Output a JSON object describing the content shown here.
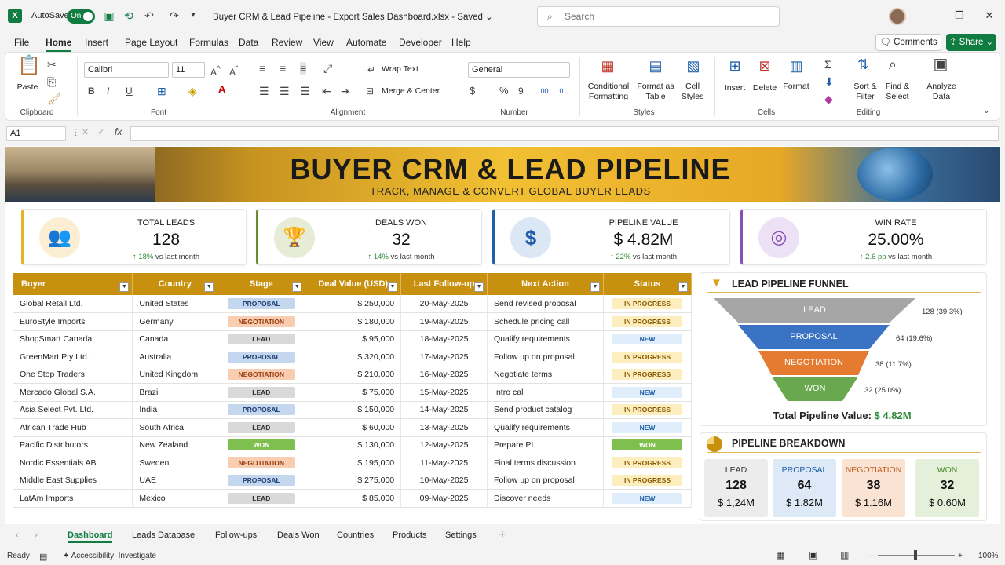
{
  "app": {
    "autosave_label": "AutoSave",
    "autosave_state": "On",
    "doc_title": "Buyer CRM & Lead Pipeline - Export Sales Dashboard.xlsx",
    "save_status": "Saved",
    "search_placeholder": "Search"
  },
  "menu": {
    "items": [
      "File",
      "Home",
      "Insert",
      "Page Layout",
      "Formulas",
      "Data",
      "Review",
      "View",
      "Automate",
      "Developer",
      "Help"
    ],
    "active": "Home",
    "comments_label": "Comments",
    "share_label": "Share"
  },
  "ribbon": {
    "clipboard": {
      "paste": "Paste",
      "group": "Clipboard"
    },
    "font": {
      "name": "Calibri",
      "size": "11",
      "group": "Font"
    },
    "alignment": {
      "wrap": "Wrap Text",
      "merge": "Merge & Center",
      "group": "Alignment"
    },
    "number": {
      "format": "General",
      "group": "Number"
    },
    "styles": {
      "cond": "Conditional Formatting",
      "fmt_table": "Format as Table",
      "cell_styles": "Cell Styles",
      "group": "Styles"
    },
    "cells": {
      "insert": "Insert",
      "delete": "Delete",
      "format": "Format",
      "group": "Cells"
    },
    "editing": {
      "sort": "Sort & Filter",
      "find": "Find & Select",
      "group": "Editing"
    },
    "analyze": "Analyze Data"
  },
  "formula_bar": {
    "cell": "A1",
    "fx": "fx"
  },
  "banner": {
    "title": "BUYER CRM & LEAD PIPELINE",
    "subtitle": "TRACK, MANAGE & CONVERT GLOBAL BUYER LEADS"
  },
  "kpis": [
    {
      "title": "TOTAL LEADS",
      "value": "128",
      "change": "18%",
      "suffix": "vs last month",
      "color": "#e8b12a",
      "bg": "#fbeed3"
    },
    {
      "title": "DEALS WON",
      "value": "32",
      "change": "14%",
      "suffix": "vs last month",
      "color": "#6d8a2b",
      "bg": "#e6ecd6"
    },
    {
      "title": "PIPELINE VALUE",
      "value": "$ 4.82M",
      "change": "22%",
      "suffix": "vs last month",
      "color": "#1f5ea8",
      "bg": "#dbe7f4"
    },
    {
      "title": "WIN RATE",
      "value": "25.00%",
      "change": "2.6 pp",
      "suffix": "vs last month",
      "color": "#8a4fb4",
      "bg": "#ede2f5"
    }
  ],
  "table": {
    "headers": [
      "Buyer",
      "Country",
      "Stage",
      "Deal Value (USD)",
      "Last Follow-up",
      "Next Action",
      "Status"
    ],
    "rows": [
      [
        "Global Retail Ltd.",
        "United States",
        "PROPOSAL",
        "$ 250,000",
        "20-May-2025",
        "Send revised proposal",
        "IN PROGRESS"
      ],
      [
        "EuroStyle Imports",
        "Germany",
        "NEGOTIATION",
        "$ 180,000",
        "19-May-2025",
        "Schedule pricing call",
        "IN PROGRESS"
      ],
      [
        "ShopSmart Canada",
        "Canada",
        "LEAD",
        "$ 95,000",
        "18-May-2025",
        "Qualify requirements",
        "NEW"
      ],
      [
        "GreenMart Pty Ltd.",
        "Australia",
        "PROPOSAL",
        "$ 320,000",
        "17-May-2025",
        "Follow up on proposal",
        "IN PROGRESS"
      ],
      [
        "One Stop Traders",
        "United Kingdom",
        "NEGOTIATION",
        "$ 210,000",
        "16-May-2025",
        "Negotiate terms",
        "IN PROGRESS"
      ],
      [
        "Mercado Global S.A.",
        "Brazil",
        "LEAD",
        "$ 75,000",
        "15-May-2025",
        "Intro call",
        "NEW"
      ],
      [
        "Asia Select Pvt. Ltd.",
        "India",
        "PROPOSAL",
        "$ 150,000",
        "14-May-2025",
        "Send product catalog",
        "IN PROGRESS"
      ],
      [
        "African Trade Hub",
        "South Africa",
        "LEAD",
        "$ 60,000",
        "13-May-2025",
        "Qualify requirements",
        "NEW"
      ],
      [
        "Pacific Distributors",
        "New Zealand",
        "WON",
        "$ 130,000",
        "12-May-2025",
        "Prepare PI",
        "WON"
      ],
      [
        "Nordic Essentials AB",
        "Sweden",
        "NEGOTIATION",
        "$ 195,000",
        "11-May-2025",
        "Final terms discussion",
        "IN PROGRESS"
      ],
      [
        "Middle East Supplies",
        "UAE",
        "PROPOSAL",
        "$ 275,000",
        "10-May-2025",
        "Follow up on proposal",
        "IN PROGRESS"
      ],
      [
        "LatAm Imports",
        "Mexico",
        "LEAD",
        "$ 85,000",
        "09-May-2025",
        "Discover needs",
        "NEW"
      ]
    ]
  },
  "stage_colors": {
    "PROPOSAL": [
      "#c5d6ef",
      "#1d3f73"
    ],
    "NEGOTIATION": [
      "#f8cdb2",
      "#9a3d10"
    ],
    "LEAD": [
      "#d9d9d9",
      "#333333"
    ],
    "WON": [
      "#7fbf4d",
      "#ffffff"
    ]
  },
  "status_colors": {
    "IN PROGRESS": [
      "#fdeec0",
      "#8a5a00"
    ],
    "NEW": [
      "#dfeefa",
      "#1f5ea8"
    ],
    "WON": [
      "#7fbf4d",
      "#ffffff"
    ]
  },
  "funnel": {
    "title": "LEAD PIPELINE FUNNEL",
    "stages": [
      {
        "name": "LEAD",
        "label": "128 (39.3%)",
        "color": "#a6a6a6"
      },
      {
        "name": "PROPOSAL",
        "label": "64 (19.6%)",
        "color": "#3a73c4"
      },
      {
        "name": "NEGOTIATION",
        "label": "38 (11.7%)",
        "color": "#e57a31"
      },
      {
        "name": "WON",
        "label": "32 (25.0%)",
        "color": "#6aa84f"
      }
    ],
    "total_label": "Total Pipeline Value:",
    "total_value": "$ 4.82M"
  },
  "breakdown": {
    "title": "PIPELINE BREAKDOWN",
    "items": [
      {
        "name": "LEAD",
        "count": "128",
        "amount": "$ 1,24M",
        "bg": "#ececec",
        "fg": "#333"
      },
      {
        "name": "PROPOSAL",
        "count": "64",
        "amount": "$ 1.82M",
        "bg": "#dde9f6",
        "fg": "#1f5ea8"
      },
      {
        "name": "NEGOTIATION",
        "count": "38",
        "amount": "$ 1.16M",
        "bg": "#fbe3d4",
        "fg": "#c05a1c"
      },
      {
        "name": "WON",
        "count": "32",
        "amount": "$ 0.60M",
        "bg": "#e4f0da",
        "fg": "#4c8a2a"
      }
    ]
  },
  "sheets": {
    "tabs": [
      "Dashboard",
      "Leads Database",
      "Follow-ups",
      "Deals Won",
      "Countries",
      "Products",
      "Settings"
    ],
    "active": "Dashboard"
  },
  "status_bar": {
    "ready": "Ready",
    "accessibility": "Accessibility: Investigate",
    "zoom": "100%"
  }
}
